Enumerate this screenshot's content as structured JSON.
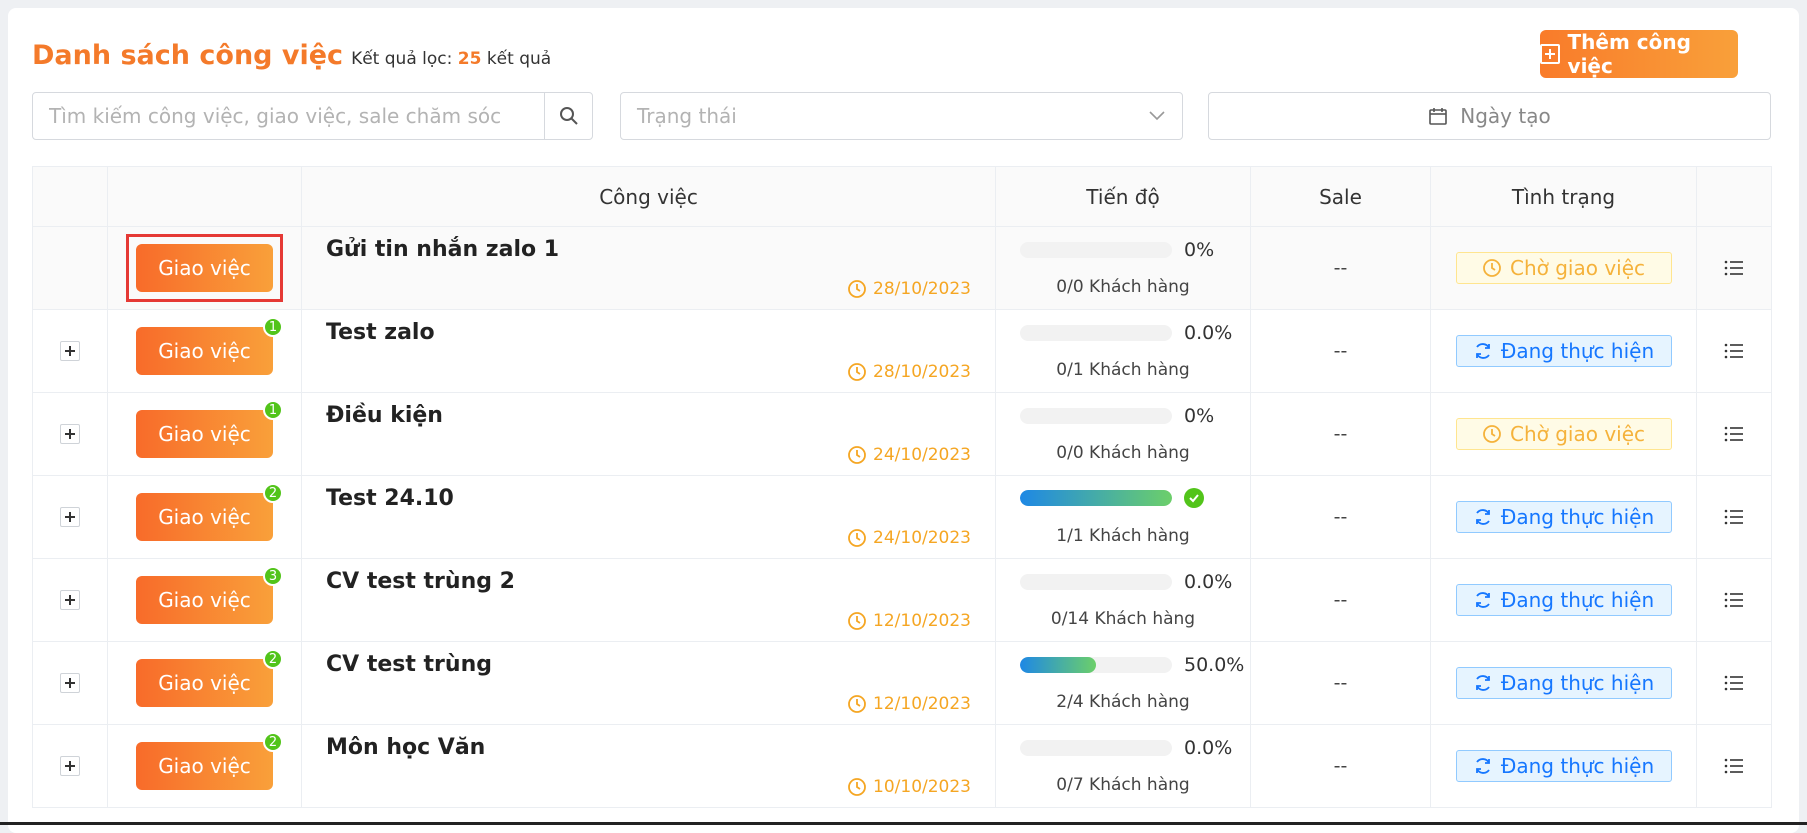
{
  "header": {
    "title": "Danh sách công việc",
    "filter_prefix": "Kết quả lọc:",
    "filter_count": "25",
    "filter_suffix": "kết quả",
    "add_button": "Thêm công việc"
  },
  "filters": {
    "search_placeholder": "Tìm kiếm công việc, giao việc, sale chăm sóc",
    "status_placeholder": "Trạng thái",
    "date_label": "Ngày tạo"
  },
  "table": {
    "columns": [
      "",
      "",
      "Công việc",
      "Tiến độ",
      "Sale",
      "Tình trạng",
      ""
    ],
    "assign_label": "Giao việc",
    "rows": [
      {
        "name": "Gửi tin nhắn zalo 1",
        "date": "28/10/2023",
        "progress_text": "0%",
        "progress": 0,
        "customers": "0/0 Khách hàng",
        "sale": "--",
        "status": "Chờ giao việc",
        "status_type": "wait",
        "badge": ""
      },
      {
        "name": "Test zalo",
        "date": "28/10/2023",
        "progress_text": "0.0%",
        "progress": 0,
        "customers": "0/1 Khách hàng",
        "sale": "--",
        "status": "Đang thực hiện",
        "status_type": "doing",
        "badge": "1"
      },
      {
        "name": "Điều kiện",
        "date": "24/10/2023",
        "progress_text": "0%",
        "progress": 0,
        "customers": "0/0 Khách hàng",
        "sale": "--",
        "status": "Chờ giao việc",
        "status_type": "wait",
        "badge": "1"
      },
      {
        "name": "Test 24.10",
        "date": "24/10/2023",
        "progress_text": "",
        "progress": 1,
        "customers": "1/1 Khách hàng",
        "sale": "--",
        "status": "Đang thực hiện",
        "status_type": "doing",
        "badge": "2"
      },
      {
        "name": "CV test trùng 2",
        "date": "12/10/2023",
        "progress_text": "0.0%",
        "progress": 0,
        "customers": "0/14 Khách hàng",
        "sale": "--",
        "status": "Đang thực hiện",
        "status_type": "doing",
        "badge": "3"
      },
      {
        "name": "CV test trùng",
        "date": "12/10/2023",
        "progress_text": "50.0%",
        "progress": 0.5,
        "customers": "2/4 Khách hàng",
        "sale": "--",
        "status": "Đang thực hiện",
        "status_type": "doing",
        "badge": "2"
      },
      {
        "name": "Môn học Văn",
        "date": "10/10/2023",
        "progress_text": "0.0%",
        "progress": 0,
        "customers": "0/7 Khách hàng",
        "sale": "--",
        "status": "Đang thực hiện",
        "status_type": "doing",
        "badge": "2"
      }
    ]
  },
  "colors": {
    "accent": "#f47a2a",
    "badge": "#52c41a",
    "status_wait": "#f5b23b",
    "status_doing": "#1677ff"
  }
}
